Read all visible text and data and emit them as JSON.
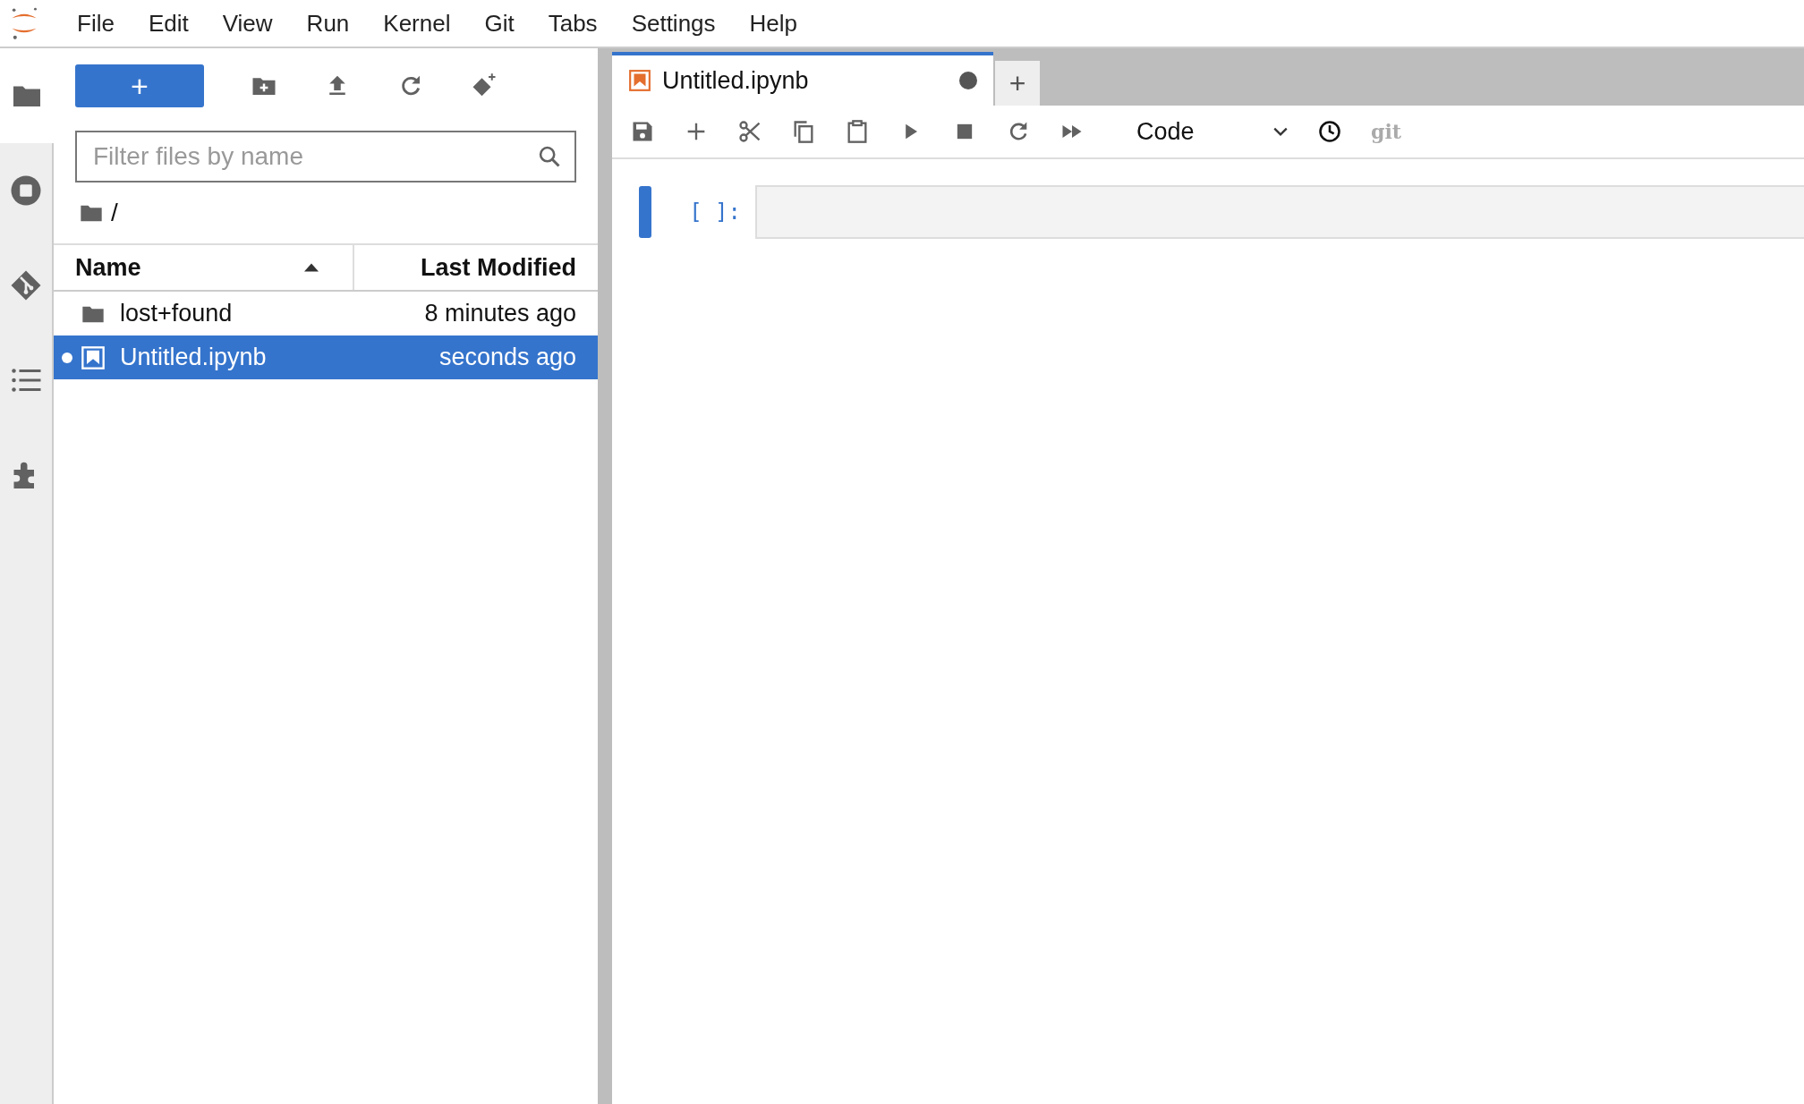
{
  "menu_bar": {
    "items": [
      "File",
      "Edit",
      "View",
      "Run",
      "Kernel",
      "Git",
      "Tabs",
      "Settings",
      "Help"
    ]
  },
  "sidebar": {
    "items": [
      {
        "kind": "files",
        "selected": true
      },
      {
        "kind": "running",
        "selected": false
      },
      {
        "kind": "git",
        "selected": false
      },
      {
        "kind": "toc",
        "selected": false
      },
      {
        "kind": "extensions",
        "selected": false
      }
    ]
  },
  "file_browser": {
    "new_button": "+",
    "search": {
      "placeholder": "Filter files by name"
    },
    "breadcrumb": "/",
    "columns": [
      {
        "label": "Name",
        "sorted": true
      },
      {
        "label": "Last Modified",
        "sorted": false
      }
    ],
    "rows": [
      {
        "kind": "folder",
        "name": "lost+found",
        "modified": "8 minutes ago",
        "selected": false,
        "running": false
      },
      {
        "kind": "notebook",
        "name": "Untitled.ipynb",
        "modified": "seconds ago",
        "selected": true,
        "running": true
      }
    ]
  },
  "notebook": {
    "tabs": [
      {
        "title": "Untitled.ipynb",
        "selected": true,
        "dirty": true
      }
    ],
    "add_tab": "+",
    "cell_type": "Code",
    "git_label": "git",
    "cells": [
      {
        "prompt": "[ ]:",
        "active": true
      }
    ]
  }
}
